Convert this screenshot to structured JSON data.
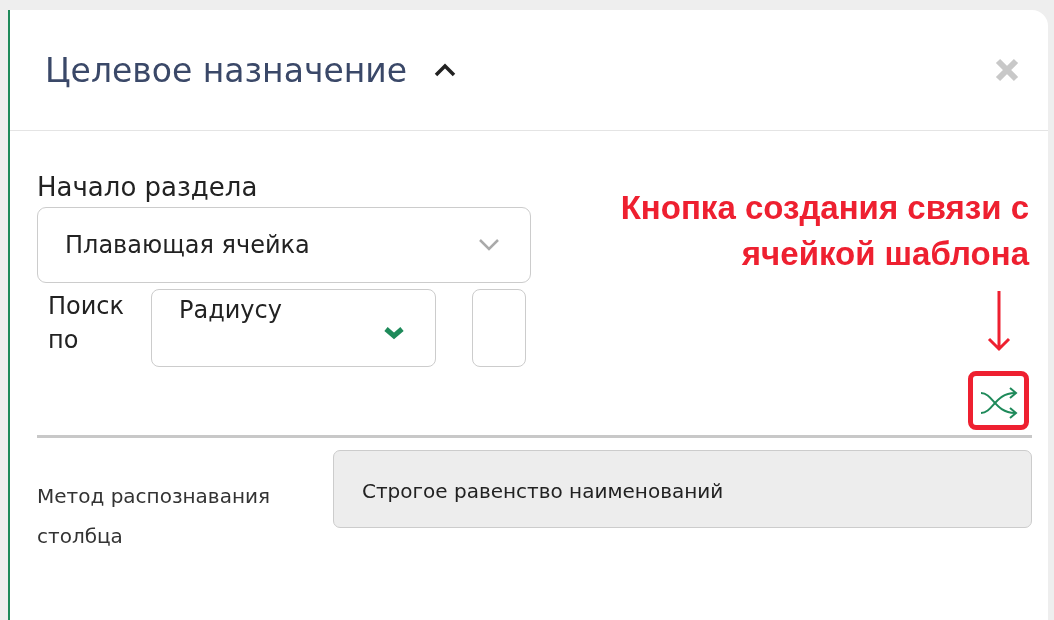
{
  "panel": {
    "title": "Целевое назначение",
    "expanded": true
  },
  "section_start": {
    "label": "Начало раздела",
    "value": "Плавающая ячейка"
  },
  "search_by": {
    "label": "Поиск по",
    "value": "Радиусу"
  },
  "annotation": {
    "text": "Кнопка создания связи с ячейкой шаблона"
  },
  "column_recognition": {
    "label": "Метод распознавания столбца",
    "value": "Строгое равенство наименований",
    "disabled": true
  }
}
